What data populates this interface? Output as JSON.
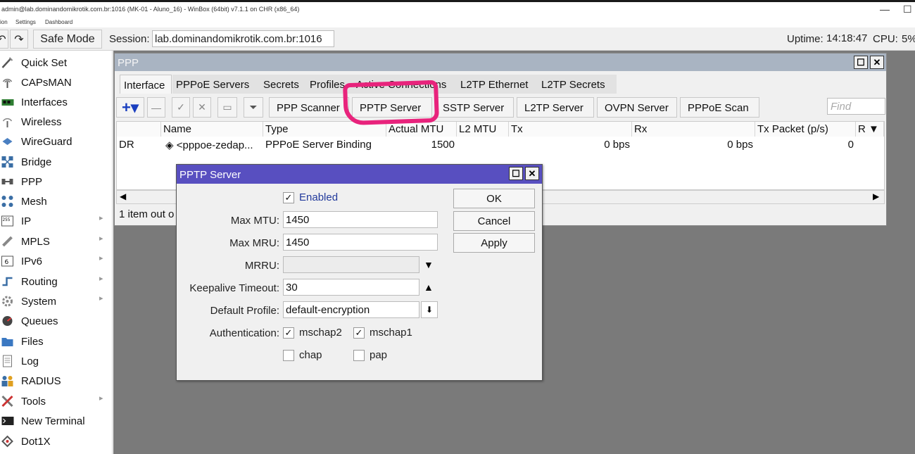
{
  "window": {
    "title": "admin@lab.dominandomikrotik.com.br:1016 (MK-01 - Aluno_16) - WinBox (64bit) v7.1.1 on CHR (x86_64)",
    "menu": [
      "ion",
      "Settings",
      "Dashboard"
    ]
  },
  "toolbar": {
    "safe_mode": "Safe Mode",
    "session_label": "Session:",
    "session_value": "lab.dominandomikrotik.com.br:1016",
    "uptime_label": "Uptime:",
    "uptime_value": "14:18:47",
    "cpu_label": "CPU:",
    "cpu_value": "5%"
  },
  "sidebar": {
    "items": [
      {
        "label": "Quick Set",
        "icon": "quickset-icon"
      },
      {
        "label": "CAPsMAN",
        "icon": "capsman-icon"
      },
      {
        "label": "Interfaces",
        "icon": "interfaces-icon"
      },
      {
        "label": "Wireless",
        "icon": "wireless-icon"
      },
      {
        "label": "WireGuard",
        "icon": "wireguard-icon"
      },
      {
        "label": "Bridge",
        "icon": "bridge-icon"
      },
      {
        "label": "PPP",
        "icon": "ppp-icon"
      },
      {
        "label": "Mesh",
        "icon": "mesh-icon"
      },
      {
        "label": "IP",
        "icon": "ip-icon"
      },
      {
        "label": "MPLS",
        "icon": "mpls-icon"
      },
      {
        "label": "IPv6",
        "icon": "ipv6-icon"
      },
      {
        "label": "Routing",
        "icon": "routing-icon"
      },
      {
        "label": "System",
        "icon": "system-icon"
      },
      {
        "label": "Queues",
        "icon": "queues-icon"
      },
      {
        "label": "Files",
        "icon": "files-icon"
      },
      {
        "label": "Log",
        "icon": "log-icon"
      },
      {
        "label": "RADIUS",
        "icon": "radius-icon"
      },
      {
        "label": "Tools",
        "icon": "tools-icon"
      },
      {
        "label": "New Terminal",
        "icon": "terminal-icon"
      },
      {
        "label": "Dot1X",
        "icon": "dot1x-icon"
      }
    ]
  },
  "ppp": {
    "title": "PPP",
    "tabs": [
      "Interface",
      "PPPoE Servers",
      "Secrets",
      "Profiles",
      "Active Connections",
      "L2TP Ethernet",
      "L2TP Secrets"
    ],
    "buttons": [
      "PPP Scanner",
      "PPTP Server",
      "SSTP Server",
      "L2TP Server",
      "OVPN Server",
      "PPPoE Scan"
    ],
    "find_placeholder": "Find",
    "columns": [
      "",
      "Name",
      "Type",
      "Actual MTU",
      "L2 MTU",
      "Tx",
      "Rx",
      "Tx Packet (p/s)",
      "R"
    ],
    "row": {
      "flags": "DR",
      "name": "<pppoe-zedap...",
      "type": "PPPoE Server Binding",
      "actual_mtu": "1500",
      "l2_mtu": "",
      "tx": "0 bps",
      "rx": "0 bps",
      "tx_packet": "0"
    },
    "status": "1 item out o"
  },
  "dialog": {
    "title": "PPTP Server",
    "enabled_label": "Enabled",
    "max_mtu_label": "Max MTU:",
    "max_mtu": "1450",
    "max_mru_label": "Max MRU:",
    "max_mru": "1450",
    "mrru_label": "MRRU:",
    "mrru": "",
    "keepalive_label": "Keepalive Timeout:",
    "keepalive": "30",
    "profile_label": "Default Profile:",
    "profile": "default-encryption",
    "auth_label": "Authentication:",
    "auth": [
      "mschap2",
      "mschap1",
      "chap",
      "pap"
    ],
    "ok": "OK",
    "cancel": "Cancel",
    "apply": "Apply"
  },
  "colors": {
    "dialog_title": "#584fc0",
    "ppp_title": "#a9b4c2",
    "annotation": "#e8237c"
  }
}
